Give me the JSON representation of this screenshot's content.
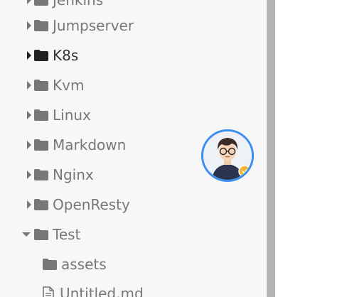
{
  "sidebar": {
    "items": [
      {
        "label": "Jenkins",
        "type": "folder",
        "state": "collapsed"
      },
      {
        "label": "Jumpserver",
        "type": "folder",
        "state": "collapsed"
      },
      {
        "label": "K8s",
        "type": "folder",
        "state": "collapsed",
        "active": true
      },
      {
        "label": "Kvm",
        "type": "folder",
        "state": "collapsed"
      },
      {
        "label": "Linux",
        "type": "folder",
        "state": "collapsed"
      },
      {
        "label": "Markdown",
        "type": "folder",
        "state": "collapsed"
      },
      {
        "label": "Nginx",
        "type": "folder",
        "state": "collapsed"
      },
      {
        "label": "OpenResty",
        "type": "folder",
        "state": "collapsed"
      },
      {
        "label": "Test",
        "type": "folder",
        "state": "expanded"
      },
      {
        "label": "assets",
        "type": "folder",
        "state": "none"
      },
      {
        "label": "Untitled.md",
        "type": "file",
        "state": "none"
      }
    ]
  },
  "icons": {
    "collapsed_arrow": "caret-right-icon",
    "expanded_arrow": "caret-down-icon",
    "folder": "folder-icon",
    "file": "file-icon"
  },
  "colors": {
    "sidebar_bg": "#f7f7f7",
    "text_muted": "#777777",
    "text_active": "#333333",
    "icon_muted": "#777777",
    "icon_active": "#222222",
    "scrollbar": "#b3b3b3",
    "avatar_ring": "#3d8ef0"
  },
  "avatar": {
    "icon": "user-avatar-icon"
  }
}
